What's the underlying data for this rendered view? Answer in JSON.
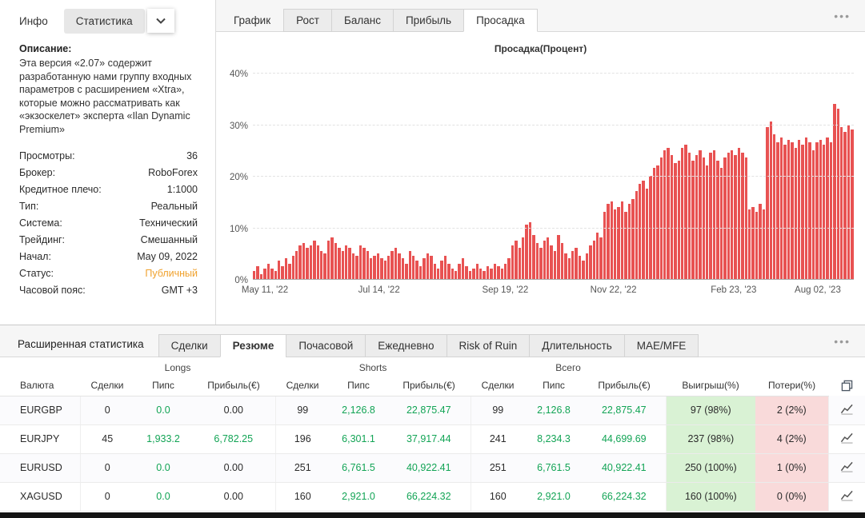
{
  "colors": {
    "accent_green": "#12a455",
    "status_orange": "#f0a22e",
    "bar_red": "#e85252",
    "win_bg": "#d9f2d4",
    "loss_bg": "#f9dada"
  },
  "icons": {
    "chevron": "chevron-down-icon",
    "more": "more-menu-icon",
    "row_chart": "equity-chart-icon",
    "export": "copy-report-icon"
  },
  "left_panel": {
    "tabs": [
      "Инфо",
      "Статистика"
    ],
    "active_tab": "Статистика",
    "description_label": "Описание:",
    "description": "Эта версия «2.07» содержит разработанную нами группу входных параметров с расширением «Xtra», которые можно рассматривать как «экзоскелет» эксперта «Ilan Dynamic Premium»",
    "fields": [
      {
        "label": "Просмотры:",
        "value": "36"
      },
      {
        "label": "Брокер:",
        "value": "RoboForex"
      },
      {
        "label": "Кредитное плечо:",
        "value": "1:1000"
      },
      {
        "label": "Тип:",
        "value": "Реальный"
      },
      {
        "label": "Система:",
        "value": "Технический"
      },
      {
        "label": "Трейдинг:",
        "value": "Смешанный"
      },
      {
        "label": "Начал:",
        "value": "May 09, 2022"
      },
      {
        "label": "Статус:",
        "value": "Публичный",
        "highlight": true
      },
      {
        "label": "Часовой пояс:",
        "value": "GMT +3"
      }
    ]
  },
  "chart_panel": {
    "tabs": [
      "График",
      "Рост",
      "Баланс",
      "Прибыль",
      "Просадка"
    ],
    "active_tab": "Просадка"
  },
  "chart_data": {
    "type": "bar",
    "title": "Просадка(Процент)",
    "ylabel": "%",
    "ylim": [
      0,
      42
    ],
    "grid": true,
    "yticks": [
      {
        "label": "0%",
        "value": 0
      },
      {
        "label": "10%",
        "value": 10
      },
      {
        "label": "20%",
        "value": 20
      },
      {
        "label": "30%",
        "value": 30
      },
      {
        "label": "40%",
        "value": 40
      }
    ],
    "x_ticks": [
      {
        "label": "May 11, '22",
        "pos_pct": 2
      },
      {
        "label": "Jul 14, '22",
        "pos_pct": 21
      },
      {
        "label": "Sep 19, '22",
        "pos_pct": 42
      },
      {
        "label": "Nov 22, '22",
        "pos_pct": 60
      },
      {
        "label": "Feb 23, '23",
        "pos_pct": 80
      },
      {
        "label": "Aug 02, '23",
        "pos_pct": 94
      }
    ],
    "values": [
      1.5,
      2.5,
      1,
      2,
      3,
      2,
      1.5,
      3.5,
      2.5,
      4,
      3,
      4.5,
      5.5,
      6.5,
      7,
      6,
      6.5,
      7.5,
      6.5,
      5.5,
      5,
      7.5,
      8,
      7,
      6,
      5.5,
      6.5,
      6,
      5,
      4.5,
      6.5,
      6,
      5.5,
      4,
      4.5,
      5,
      4,
      3.5,
      4.5,
      5.5,
      6,
      5,
      4,
      3,
      5.5,
      4.5,
      3.5,
      2.5,
      4,
      5,
      4.5,
      3,
      2,
      3.5,
      4.5,
      3,
      2,
      1.5,
      3,
      4,
      2.5,
      1.5,
      2,
      3,
      2,
      1.5,
      2.5,
      2,
      3,
      2.5,
      2,
      3,
      4,
      6.5,
      7.5,
      6,
      8,
      10.5,
      11,
      8.5,
      7,
      6,
      7.5,
      8,
      6.5,
      5.5,
      8.5,
      7,
      5,
      4,
      5.5,
      6,
      4.5,
      3.5,
      5,
      6.5,
      7.5,
      9,
      8,
      13,
      14.5,
      15,
      13.5,
      14,
      15,
      13,
      14.5,
      15.5,
      17,
      18.5,
      19,
      17.5,
      20,
      21.5,
      22,
      23.5,
      25,
      25.5,
      24,
      22.5,
      23,
      25.5,
      26,
      24.5,
      23,
      24,
      25,
      23.5,
      22,
      24.5,
      25,
      23,
      21.5,
      23.5,
      24.5,
      25,
      24,
      25.5,
      24.5,
      23.5,
      13.5,
      14,
      13,
      14.5,
      13.5,
      29.5,
      30.5,
      28,
      26.5,
      27.5,
      26,
      27,
      26.5,
      25.5,
      27,
      26,
      27.5,
      26.5,
      25,
      26.5,
      27,
      26,
      27.5,
      26.5,
      34,
      33,
      29.5,
      28.5,
      30,
      29
    ]
  },
  "bottom_panel": {
    "title": "Расширенная статистика",
    "tabs": [
      "Сделки",
      "Резюме",
      "Почасовой",
      "Ежедневно",
      "Risk of Ruin",
      "Длительность",
      "MAE/MFE"
    ],
    "active_tab": "Резюме"
  },
  "table": {
    "groups": [
      "Longs",
      "Shorts",
      "Всего"
    ],
    "columns": [
      "Валюта",
      "Сделки",
      "Пипс",
      "Прибыль(€)",
      "Сделки",
      "Пипс",
      "Прибыль(€)",
      "Сделки",
      "Пипс",
      "Прибыль(€)",
      "Выигрыш(%)",
      "Потери(%)"
    ],
    "rows": [
      {
        "currency": "EURGBP",
        "cells": [
          "0",
          "0.0",
          "0.00",
          "99",
          "2,126.8",
          "22,875.47",
          "99",
          "2,126.8",
          "22,875.47"
        ],
        "wins": "97 (98%)",
        "losses": "2 (2%)"
      },
      {
        "currency": "EURJPY",
        "cells": [
          "45",
          "1,933.2",
          "6,782.25",
          "196",
          "6,301.1",
          "37,917.44",
          "241",
          "8,234.3",
          "44,699.69"
        ],
        "wins": "237 (98%)",
        "losses": "4 (2%)"
      },
      {
        "currency": "EURUSD",
        "cells": [
          "0",
          "0.0",
          "0.00",
          "251",
          "6,761.5",
          "40,922.41",
          "251",
          "6,761.5",
          "40,922.41"
        ],
        "wins": "250 (100%)",
        "losses": "1 (0%)"
      },
      {
        "currency": "XAGUSD",
        "cells": [
          "0",
          "0.0",
          "0.00",
          "160",
          "2,921.0",
          "66,224.32",
          "160",
          "2,921.0",
          "66,224.32"
        ],
        "wins": "160 (100%)",
        "losses": "0 (0%)"
      }
    ]
  }
}
